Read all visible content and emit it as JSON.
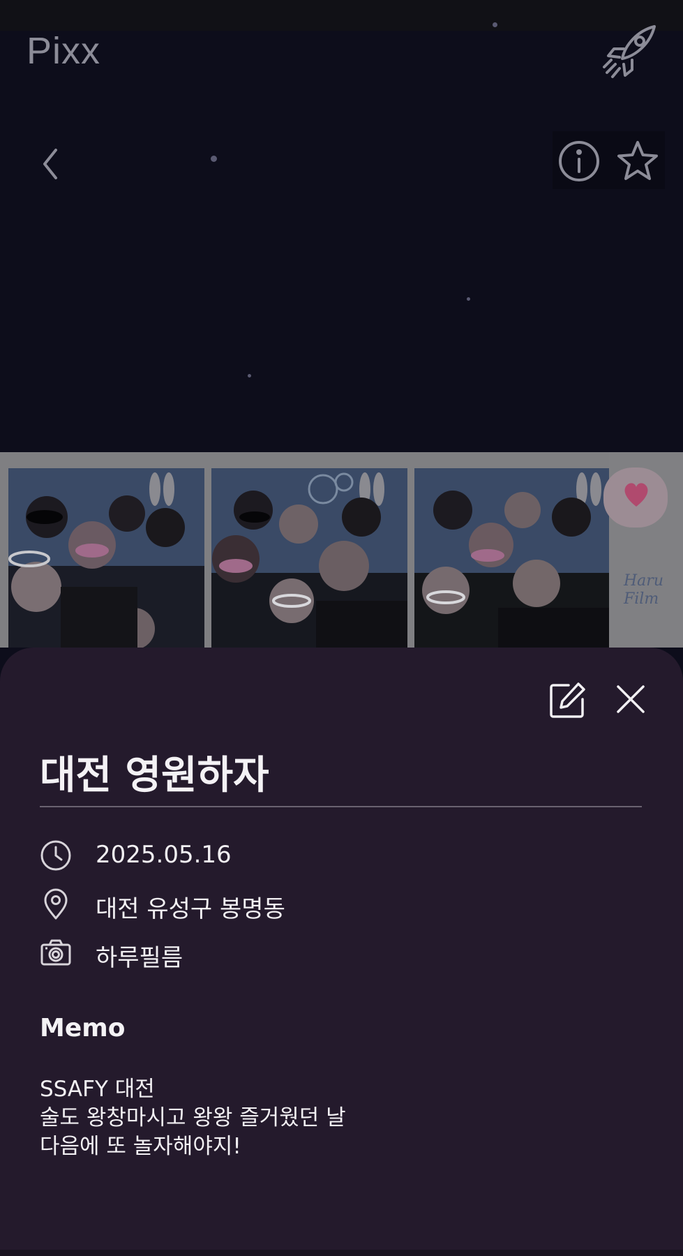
{
  "app": {
    "title": "Pixx"
  },
  "header": {
    "rocket_icon": "rocket-icon",
    "back_icon": "chevron-left-icon",
    "info_icon": "info-circle-icon",
    "favorite_icon": "star-outline-icon"
  },
  "photo": {
    "brand_mark": "Haru Film",
    "frames": 3
  },
  "detail": {
    "edit_icon": "edit-icon",
    "close_icon": "close-icon",
    "title": "대전 영원하자",
    "date": "2025.05.16",
    "location": "대전 유성구 봉명동",
    "booth": "하루필름",
    "memo_heading": "Memo",
    "memo_lines": [
      "SSAFY 대전",
      "술도 왕창마시고 왕왕 즐거웠던 날",
      "다음에 또 놀자해야지!"
    ]
  },
  "colors": {
    "background": "#0d0d1b",
    "sheet": "#241a2c",
    "text": "#f2f0f3",
    "muted": "#8c8c98"
  }
}
